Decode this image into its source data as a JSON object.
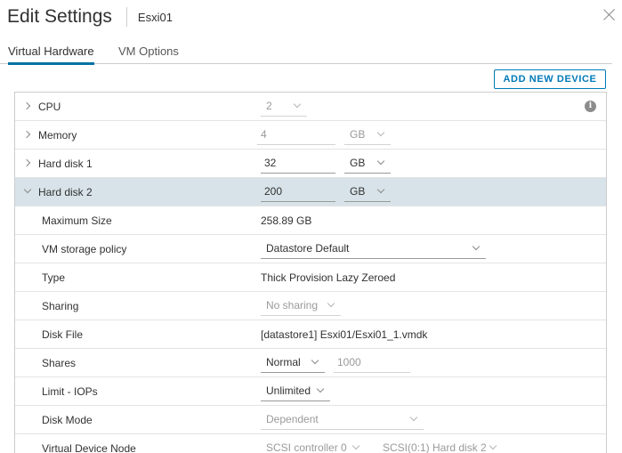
{
  "dialog": {
    "title": "Edit Settings",
    "subtitle": "Esxi01"
  },
  "tabs": [
    {
      "label": "Virtual Hardware",
      "active": true
    },
    {
      "label": "VM Options",
      "active": false
    }
  ],
  "toolbar": {
    "add_device_label": "ADD NEW DEVICE"
  },
  "rows": {
    "cpu": {
      "label": "CPU",
      "value": "2"
    },
    "memory": {
      "label": "Memory",
      "value": "4",
      "unit": "GB"
    },
    "hard_disk_1": {
      "label": "Hard disk 1",
      "value": "32",
      "unit": "GB"
    },
    "hard_disk_2": {
      "label": "Hard disk 2",
      "value": "200",
      "unit": "GB"
    },
    "max_size": {
      "label": "Maximum Size",
      "value": "258.89 GB"
    },
    "storage_policy": {
      "label": "VM storage policy",
      "value": "Datastore Default"
    },
    "type": {
      "label": "Type",
      "value": "Thick Provision Lazy Zeroed"
    },
    "sharing": {
      "label": "Sharing",
      "value": "No sharing"
    },
    "disk_file": {
      "label": "Disk File",
      "value": "[datastore1] Esxi01/Esxi01_1.vmdk"
    },
    "shares": {
      "label": "Shares",
      "value": "Normal",
      "amount": "1000"
    },
    "limit_iops": {
      "label": "Limit - IOPs",
      "value": "Unlimited"
    },
    "disk_mode": {
      "label": "Disk Mode",
      "value": "Dependent"
    },
    "device_node": {
      "label": "Virtual Device Node",
      "controller": "SCSI controller 0",
      "slot": "SCSI(0:1) Hard disk 2"
    }
  },
  "icons": {
    "info": "info-icon",
    "close": "close-icon",
    "expand": "chevron-right-icon",
    "collapse": "chevron-down-icon",
    "dropdown": "chevron-down-icon"
  },
  "colors": {
    "accent": "#0079b8",
    "selected_row": "#d8e3e9"
  }
}
